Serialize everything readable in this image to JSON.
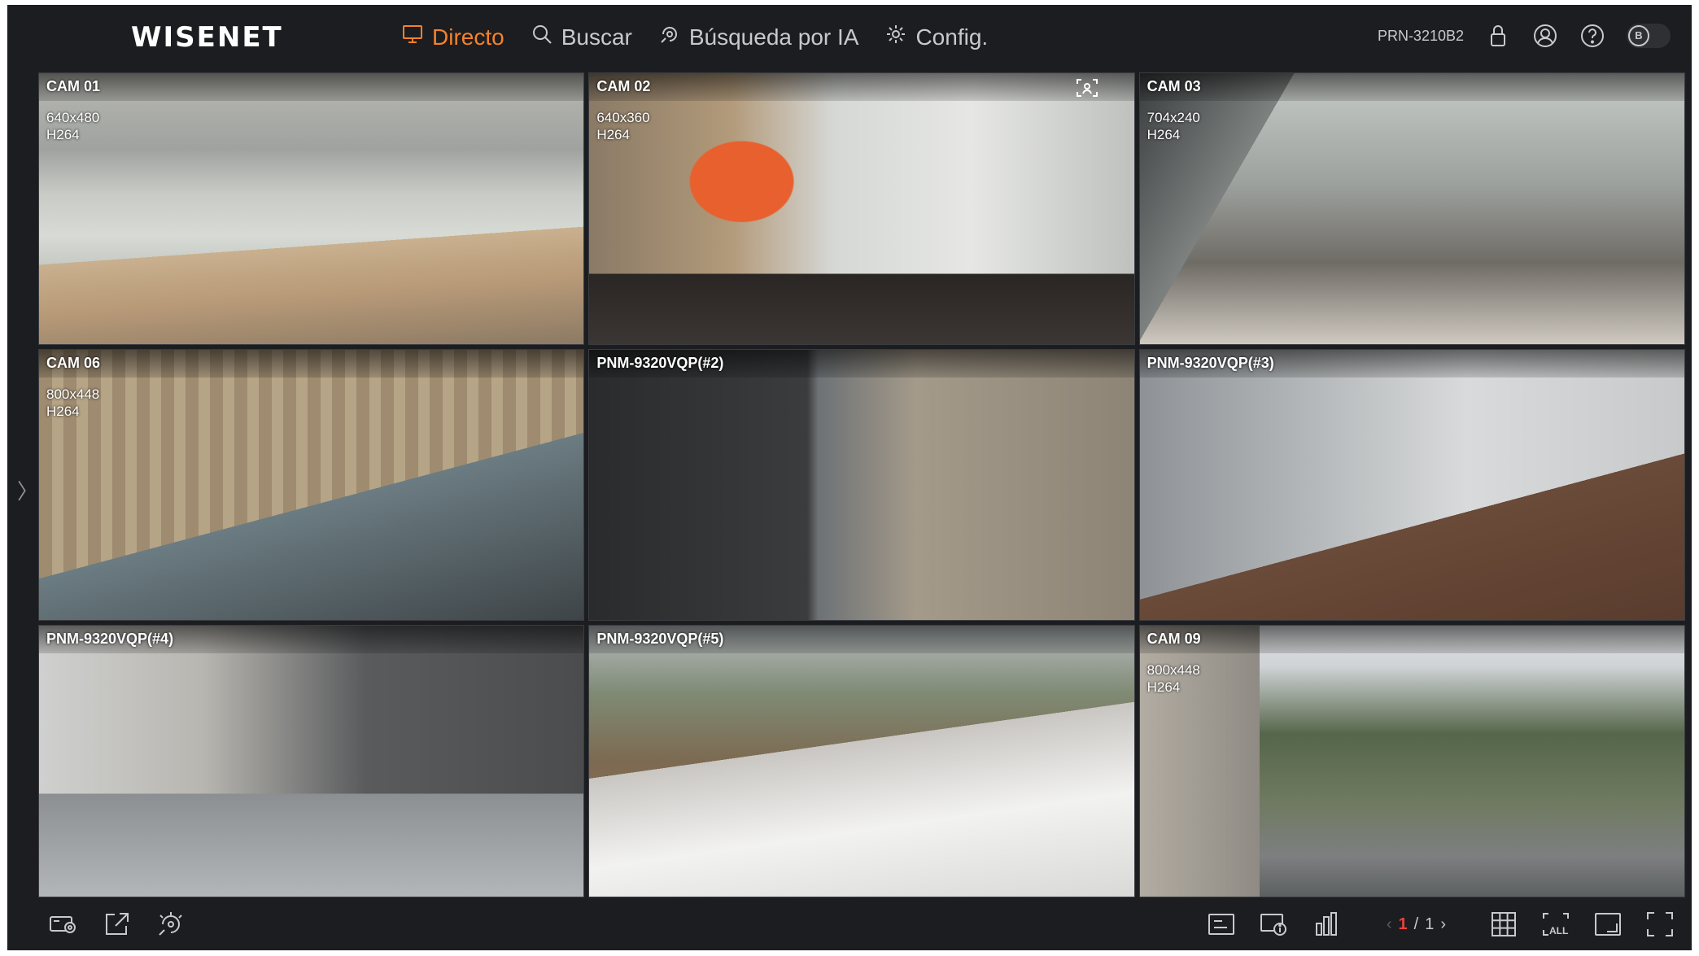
{
  "brand": "WISENET",
  "nav": [
    {
      "label": "Directo",
      "icon": "monitor-icon",
      "active": true
    },
    {
      "label": "Buscar",
      "icon": "search-icon",
      "active": false
    },
    {
      "label": "Búsqueda por IA",
      "icon": "ai-search-icon",
      "active": false
    },
    {
      "label": "Config.",
      "icon": "gear-icon",
      "active": false
    }
  ],
  "device": {
    "model": "PRN-3210B2",
    "badge": "B"
  },
  "colors": {
    "accent": "#f5822a",
    "page_current": "#e8423a",
    "background": "#1c1d20"
  },
  "cameras": [
    {
      "title": "CAM 01",
      "resolution": "640x480",
      "codec": "H264"
    },
    {
      "title": "CAM 02",
      "resolution": "640x360",
      "codec": "H264",
      "ai": true
    },
    {
      "title": "CAM 03",
      "resolution": "704x240",
      "codec": "H264"
    },
    {
      "title": "CAM 06",
      "resolution": "800x448",
      "codec": "H264"
    },
    {
      "title": "PNM-9320VQP(#2)"
    },
    {
      "title": "PNM-9320VQP(#3)"
    },
    {
      "title": "PNM-9320VQP(#4)"
    },
    {
      "title": "PNM-9320VQP(#5)"
    },
    {
      "title": "CAM 09",
      "resolution": "800x448",
      "codec": "H264"
    }
  ],
  "pager": {
    "current": "1",
    "separator": "/",
    "total": "1"
  },
  "bottom_icons_left": [
    "camera-settings-icon",
    "export-icon",
    "ai-event-icon"
  ],
  "bottom_icons_right": [
    "osd-icon",
    "camera-info-icon",
    "statistics-icon",
    "grid-layout-icon",
    "all-channels-icon",
    "fit-screen-icon",
    "fullscreen-icon"
  ]
}
